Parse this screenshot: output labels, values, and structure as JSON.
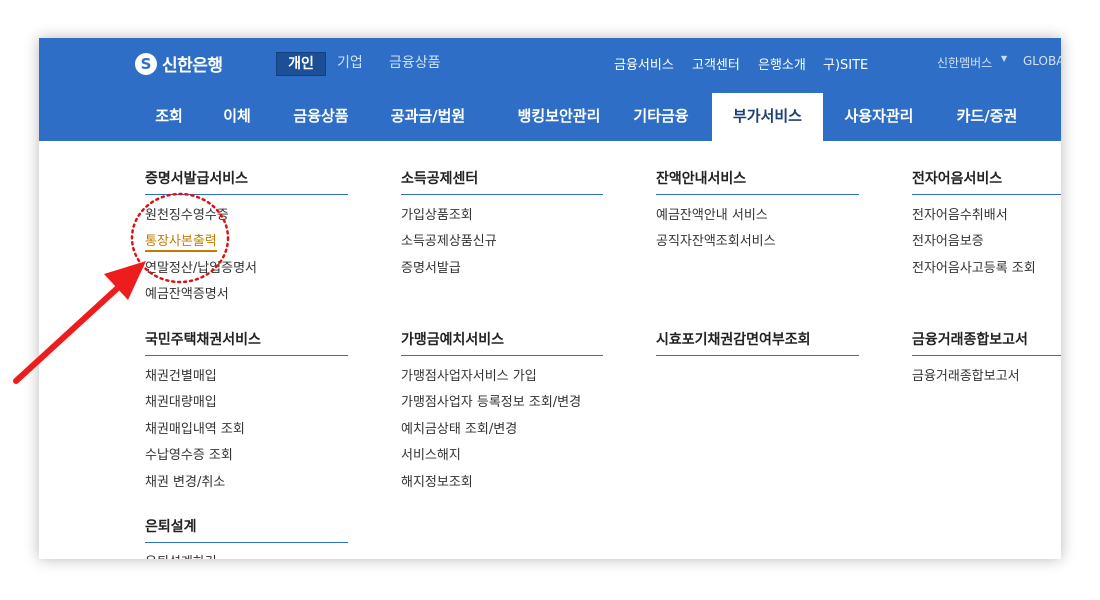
{
  "header": {
    "logo_text": "신한은행",
    "logo_icon": "shinhan-s-logo",
    "segments": [
      "개인",
      "기업",
      "금융상품"
    ],
    "active_segment": "개인",
    "utility_links": [
      "금융서비스",
      "고객센터",
      "은행소개",
      "구)SITE"
    ],
    "membership": "신한멤버스",
    "global": "GLOBA"
  },
  "nav": {
    "items": [
      "조회",
      "이체",
      "금융상품",
      "공과금/법원",
      "뱅킹보안관리",
      "기타금융",
      "부가서비스",
      "사용자관리",
      "카드/증권"
    ],
    "active": "부가서비스"
  },
  "dropdown": {
    "groups": [
      {
        "title": "증명서발급서비스",
        "items": [
          "원천징수영수증",
          "통장사본출력",
          "연말정산/납입증명서",
          "예금잔액증명서"
        ]
      },
      {
        "title": "소득공제센터",
        "items": [
          "가입상품조회",
          "소득공제상품신규",
          "증명서발급"
        ]
      },
      {
        "title": "잔액안내서비스",
        "items": [
          "예금잔액안내 서비스",
          "공직자잔액조회서비스"
        ]
      },
      {
        "title": "전자어음서비스",
        "items": [
          "전자어음수취배서",
          "전자어음보증",
          "전자어음사고등록 조회"
        ]
      },
      {
        "title": "국민주택채권서비스",
        "items": [
          "채권건별매입",
          "채권대량매입",
          "채권매입내역 조회",
          "수납영수증 조회",
          "채권 변경/취소"
        ]
      },
      {
        "title": "가맹금예치서비스",
        "items": [
          "가맹점사업자서비스 가입",
          "가맹점사업자 등록정보 조회/변경",
          "예치금상태 조회/변경",
          "서비스해지",
          "해지정보조회"
        ]
      },
      {
        "title": "시효포기채권감면여부조회",
        "items": []
      },
      {
        "title": "금융거래종합보고서",
        "items": [
          "금융거래종합보고서"
        ]
      },
      {
        "title": "은퇴설계",
        "items": [
          "은퇴설계하기"
        ]
      }
    ],
    "highlighted_item": "통장사본출력"
  },
  "annotation": {
    "arrow_color": "#ee1c1c",
    "circle_color": "#e01010"
  },
  "colors": {
    "header_blue": "#2f6ec6",
    "active_segment_bg": "#1d4f96",
    "highlight_text": "#c17c00"
  }
}
